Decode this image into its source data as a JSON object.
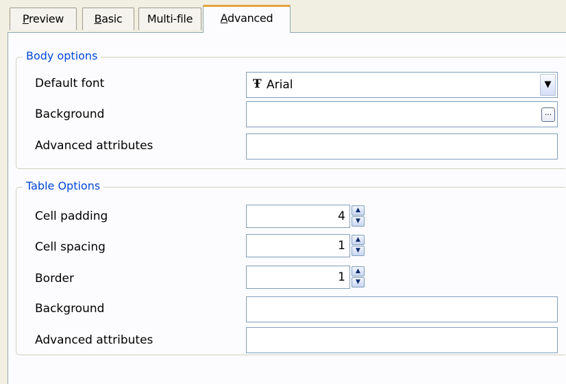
{
  "tabs": [
    {
      "label": "Preview",
      "accel": "P",
      "rest": "review"
    },
    {
      "label": "Basic",
      "accel": "B",
      "rest": "asic"
    },
    {
      "label": "Multi-file",
      "accel": "",
      "rest": "Multi-file"
    },
    {
      "label": "Advanced",
      "accel": "A",
      "rest": "dvanced",
      "active": true
    }
  ],
  "body_options": {
    "legend": "Body options",
    "default_font_label": "Default font",
    "default_font_value": "Arial",
    "background_label": "Background",
    "background_value": "",
    "background_button": "...",
    "advanced_label": "Advanced attributes",
    "advanced_value": ""
  },
  "table_options": {
    "legend": "Table Options",
    "cell_padding_label": "Cell padding",
    "cell_padding_value": "4",
    "cell_spacing_label": "Cell spacing",
    "cell_spacing_value": "1",
    "border_label": "Border",
    "border_value": "1",
    "background_label": "Background",
    "background_value": "",
    "advanced_label": "Advanced attributes",
    "advanced_value": ""
  },
  "icons": {
    "font": "truetype-font-icon",
    "dropdown": "chevron-down-icon",
    "spin_up": "spin-up-icon",
    "spin_down": "spin-down-icon"
  },
  "colors": {
    "legend": "#0046d5",
    "active_tab_accent": "#e6a23c",
    "field_border": "#7f9db9"
  }
}
